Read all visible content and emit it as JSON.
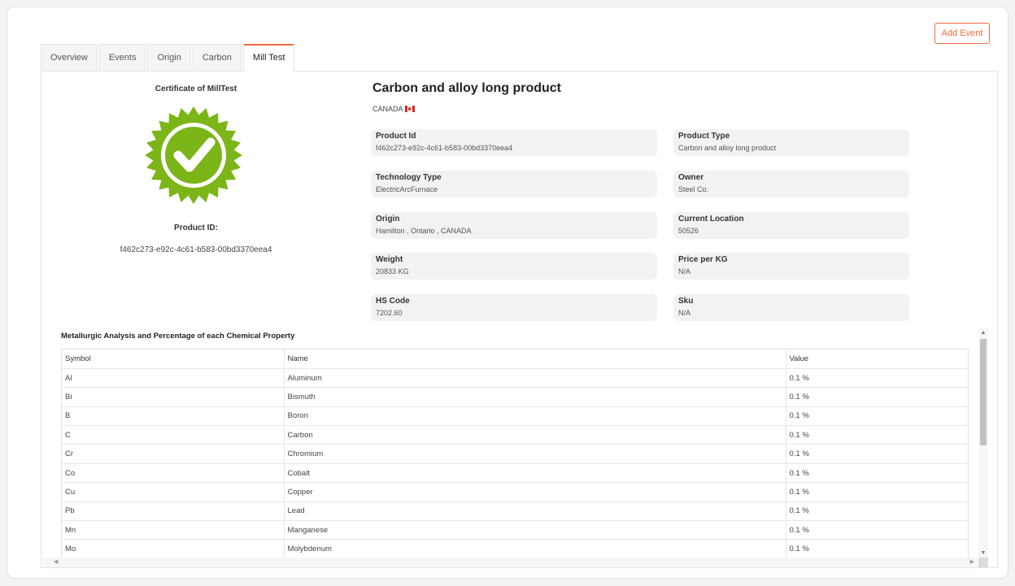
{
  "header": {
    "add_event_label": "Add Event"
  },
  "tabs": [
    {
      "label": "Overview",
      "active": false
    },
    {
      "label": "Events",
      "active": false
    },
    {
      "label": "Origin",
      "active": false
    },
    {
      "label": "Carbon",
      "active": false
    },
    {
      "label": "Mill Test",
      "active": true
    }
  ],
  "certificate": {
    "title": "Certificate of MillTest",
    "badge_icon": "certified-check-icon",
    "badge_color": "#7cb518",
    "product_id_label": "Product ID:",
    "product_id": "f462c273-e92c-4c61-b583-00bd3370eea4"
  },
  "product": {
    "title": "Carbon and alloy long product",
    "country": "CANADA",
    "country_flag_icon": "canada-flag-icon",
    "fields": [
      {
        "label": "Product Id",
        "value": "f462c273-e92c-4c61-b583-00bd3370eea4"
      },
      {
        "label": "Product Type",
        "value": "Carbon and alloy long product"
      },
      {
        "label": "Technology Type",
        "value": "ElectricArcFurnace"
      },
      {
        "label": "Owner",
        "value": "Steel Co."
      },
      {
        "label": "Origin",
        "value": "Hamilton , Ontario , CANADA"
      },
      {
        "label": "Current Location",
        "value": "50526"
      },
      {
        "label": "Weight",
        "value": "20833 KG"
      },
      {
        "label": "Price per KG",
        "value": "N/A"
      },
      {
        "label": "HS Code",
        "value": "7202.60"
      },
      {
        "label": "Sku",
        "value": "N/A"
      }
    ]
  },
  "analysis": {
    "title": "Metallurgic Analysis and Percentage of each Chemical Property",
    "columns": [
      "Symbol",
      "Name",
      "Value"
    ],
    "rows": [
      [
        "Al",
        "Aluminum",
        "0.1 %"
      ],
      [
        "Bi",
        "Bismuth",
        "0.1 %"
      ],
      [
        "B",
        "Boron",
        "0.1 %"
      ],
      [
        "C",
        "Carbon",
        "0.1 %"
      ],
      [
        "Cr",
        "Chromium",
        "0.1 %"
      ],
      [
        "Co",
        "Cobalt",
        "0.1 %"
      ],
      [
        "Cu",
        "Copper",
        "0.1 %"
      ],
      [
        "Pb",
        "Lead",
        "0.1 %"
      ],
      [
        "Mn",
        "Manganese",
        "0.1 %"
      ],
      [
        "Mo",
        "Molybdenum",
        "0.1 %"
      ]
    ]
  },
  "colors": {
    "accent": "#f26b3a",
    "field_bg": "#f2f2f2"
  }
}
